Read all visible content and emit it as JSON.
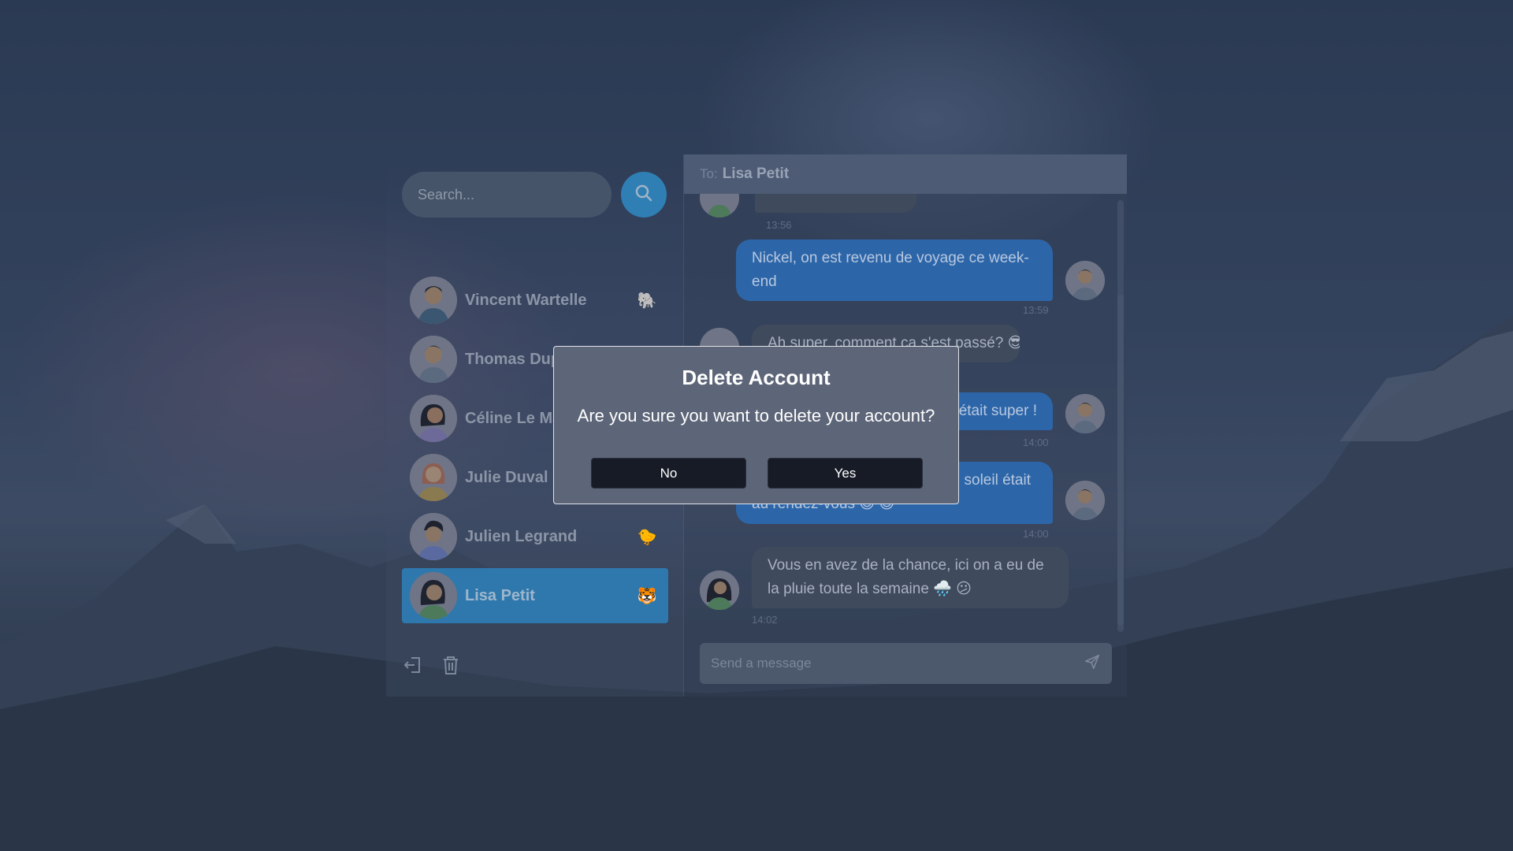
{
  "search": {
    "placeholder": "Search..."
  },
  "contacts": [
    {
      "name": "Vincent Wartelle",
      "emoji": "🐘"
    },
    {
      "name": "Thomas Dup",
      "emoji": ""
    },
    {
      "name": "Céline Le Ma",
      "emoji": ""
    },
    {
      "name": "Julie Duval",
      "emoji": ""
    },
    {
      "name": "Julien Legrand",
      "emoji": "🐤"
    },
    {
      "name": "Lisa Petit",
      "emoji": "🐯"
    }
  ],
  "chat": {
    "to_label": "To:",
    "recipient": "Lisa Petit",
    "messages": [
      {
        "direction": "in",
        "text": "",
        "time": "13:56"
      },
      {
        "direction": "out",
        "text": "Nickel, on est revenu de voyage ce week-end",
        "time": "13:59"
      },
      {
        "direction": "in",
        "text": "Ah super, comment ça s'est passé? 😎",
        "time": ""
      },
      {
        "direction": "out",
        "text": "C'était super !",
        "time": "14:00"
      },
      {
        "direction": "out",
        "text": "au rendez-vous 😊 😎",
        "text_right": "soleil était",
        "time": "14:00"
      },
      {
        "direction": "in",
        "text": "Vous en avez de la chance, ici on a eu de la pluie toute la semaine 🌧️ 😕",
        "time": "14:02"
      }
    ],
    "composer_placeholder": "Send a message"
  },
  "modal": {
    "title": "Delete Account",
    "question": "Are you sure you want to delete your account?",
    "no_label": "No",
    "yes_label": "Yes"
  },
  "colors": {
    "accent": "#2f78ad",
    "outgoing_bubble": "#2d66a8",
    "incoming_bubble": "#3f4a5c",
    "modal_button": "#161b26"
  },
  "icons": {
    "search": "search-icon",
    "logout": "logout-icon",
    "delete": "trash-icon",
    "send": "send-icon"
  }
}
